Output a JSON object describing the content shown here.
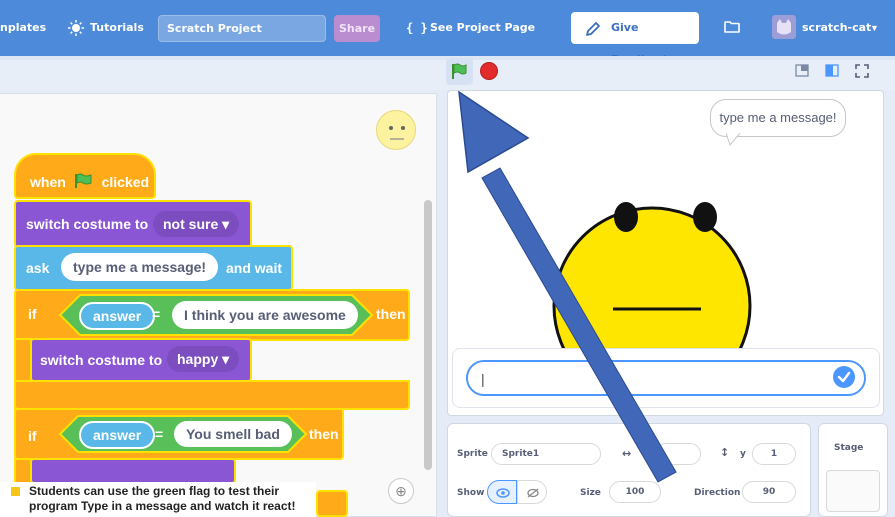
{
  "menubar": {
    "templates": "nplates",
    "tutorials": "Tutorials",
    "project_title": "Scratch Project",
    "share": "Share",
    "see_project_icon": "{ }",
    "see_project": "See Project Page",
    "feedback": "Give Feedback",
    "username": "scratch-cat",
    "icons": [
      "lightbulb-icon",
      "pencil-icon",
      "folder-icon",
      "avatar-icon",
      "caret-down-icon"
    ]
  },
  "stage_controls": {
    "icons": [
      "green-flag-icon",
      "stop-icon",
      "small-stage-icon",
      "large-stage-icon",
      "fullscreen-icon"
    ]
  },
  "code_blocks": {
    "when": "when",
    "clicked": "clicked",
    "switch_costume_1": "switch costume to",
    "costume_1": "not sure ▾",
    "ask": "ask",
    "ask_message": "type me a message!",
    "and_wait": "and wait",
    "if_1": "if",
    "answer_1": "answer",
    "equals_1": "=",
    "compare_1": "I think you are awesome",
    "then_1": "then",
    "switch_costume_2": "switch costume to",
    "costume_2": "happy ▾",
    "if_2": "if",
    "answer_2": "answer",
    "equals_2": "=",
    "compare_2": "You smell bad",
    "then_2": "then"
  },
  "stage": {
    "speech_bubble": "type me a message!",
    "answer_value": "|"
  },
  "sprite_info": {
    "sprite_label": "Sprite",
    "sprite_name": "Sprite1",
    "x_label": "x",
    "x_arrow": "↔",
    "y_label": "y",
    "y_arrow": "↕",
    "y_value": "1",
    "show_label": "Show",
    "size_label": "Size",
    "size_value": "100",
    "direction_label": "Direction",
    "direction_value": "90",
    "stage_label": "Stage"
  },
  "caption": {
    "text": "Students can use the green flag to test their program Type in a message and watch it react!"
  },
  "colors": {
    "menubar": "#4d8ad9",
    "event_orange": "#ffab19",
    "looks_purple": "#8b56d4",
    "sensing_blue": "#59b8e7",
    "operator_green": "#59c059",
    "highlight_yellow": "#ffe100",
    "arrow_blue": "#4167b8",
    "caption_square": "#f5c518"
  }
}
